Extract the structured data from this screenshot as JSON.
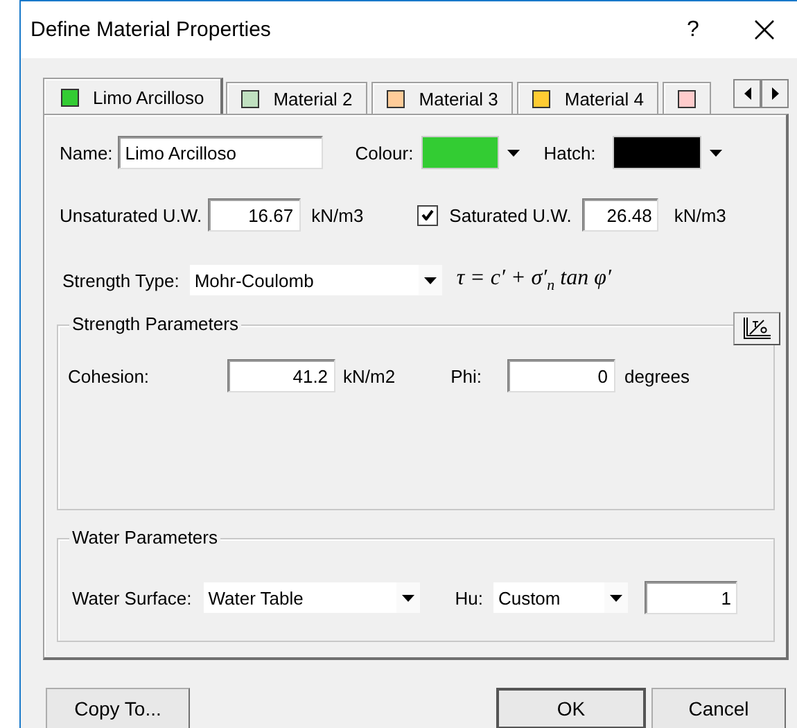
{
  "window": {
    "title": "Define Material Properties",
    "help": "?"
  },
  "tabs": [
    {
      "label": "Limo Arcilloso",
      "color": "#33cc33",
      "selected": true
    },
    {
      "label": "Material 2",
      "color": "#c0e0c0",
      "selected": false
    },
    {
      "label": "Material 3",
      "color": "#ffcc99",
      "selected": false
    },
    {
      "label": "Material 4",
      "color": "#ffcc33",
      "selected": false
    },
    {
      "color": "#ffcccc",
      "selected": false
    }
  ],
  "name": {
    "label": "Name:",
    "value": "Limo Arcilloso"
  },
  "colour": {
    "label": "Colour:",
    "color": "#33cc33"
  },
  "hatch": {
    "label": "Hatch:",
    "color": "#000000"
  },
  "unsaturated_uw": {
    "label": "Unsaturated U.W.",
    "value": "16.67",
    "unit": "kN/m3"
  },
  "saturated_uw": {
    "label": "Saturated U.W.",
    "checked": true,
    "value": "26.48",
    "unit": "kN/m3"
  },
  "strength_type": {
    "label": "Strength Type:",
    "value": "Mohr-Coulomb",
    "formula": "τ = c′ + σ′$_{n}$ tan φ′"
  },
  "strength_parameters": {
    "title": "Strength Parameters",
    "cohesion": {
      "label": "Cohesion:",
      "value": "41.2",
      "unit": "kN/m2"
    },
    "phi": {
      "label": "Phi:",
      "value": "0",
      "unit": "degrees"
    }
  },
  "water_parameters": {
    "title": "Water Parameters",
    "water_surface": {
      "label": "Water Surface:",
      "value": "Water Table"
    },
    "hu": {
      "label": "Hu:",
      "value": "Custom",
      "input": "1"
    }
  },
  "buttons": [
    {
      "label": "Copy To...",
      "default": false
    },
    {
      "label": "OK",
      "default": true
    },
    {
      "label": "Cancel",
      "default": false
    }
  ]
}
